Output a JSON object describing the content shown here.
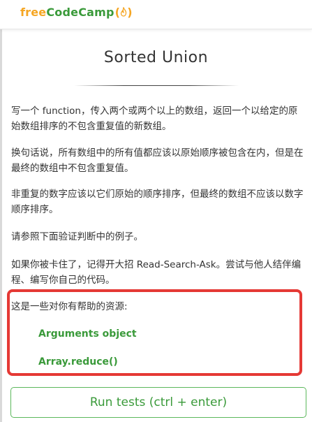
{
  "header": {
    "logo": {
      "free": "free",
      "code": "Code",
      "camp": "Camp",
      "paren_open": "(",
      "paren_close": ")",
      "icon": "fire-icon",
      "colors": {
        "free": "#f5a623",
        "codecamp": "#3a9a3a"
      }
    }
  },
  "challenge": {
    "title": "Sorted Union",
    "paragraphs": [
      "写一个 function，传入两个或两个以上的数组，返回一个以给定的原始数组排序的不包含重复值的新数组。",
      "换句话说，所有数组中的所有值都应该以原始顺序被包含在内，但是在最终的数组中不包含重复值。",
      "非重复的数字应该以它们原始的顺序排序，但最终的数组不应该以数字顺序排序。",
      "请参照下面验证判断中的例子。",
      "如果你被卡住了，记得开大招 Read-Search-Ask。尝试与他人结伴编程、编写你自己的代码。"
    ],
    "resources": {
      "intro": "这是一些对你有帮助的资源:",
      "links": [
        "Arguments object",
        "Array.reduce()"
      ]
    }
  },
  "actions": {
    "run_tests_label": "Run tests (ctrl + enter)"
  },
  "colors": {
    "accent_green": "#3a9a3a",
    "highlight_red": "#e53935",
    "text": "#333333"
  }
}
